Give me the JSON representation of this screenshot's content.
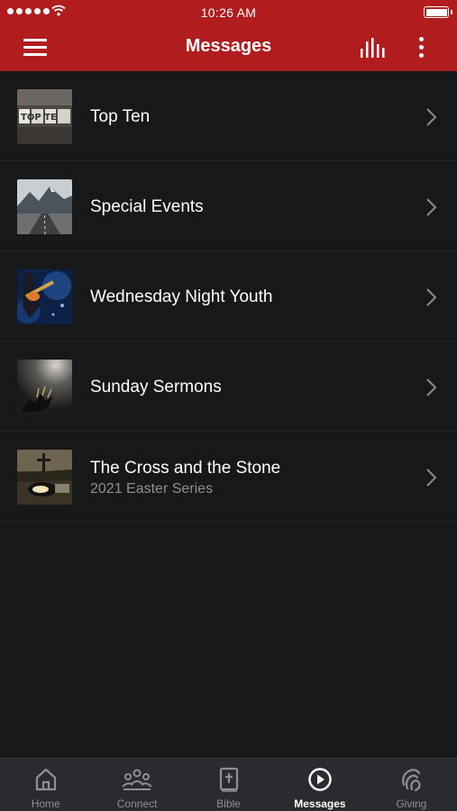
{
  "status_bar": {
    "time": "10:26 AM"
  },
  "header": {
    "title": "Messages"
  },
  "messages": [
    {
      "title": "Top Ten",
      "subtitle": "",
      "thumb_icon": "top-ten-thumbnail"
    },
    {
      "title": "Special Events",
      "subtitle": "",
      "thumb_icon": "mountain-road-thumbnail"
    },
    {
      "title": "Wednesday Night Youth",
      "subtitle": "",
      "thumb_icon": "guitar-player-thumbnail"
    },
    {
      "title": "Sunday Sermons",
      "subtitle": "",
      "thumb_icon": "hands-light-thumbnail"
    },
    {
      "title": "The Cross and the Stone",
      "subtitle": "2021 Easter Series",
      "thumb_icon": "cross-stone-thumbnail"
    }
  ],
  "tabs": [
    {
      "label": "Home",
      "icon": "home-icon",
      "active": false
    },
    {
      "label": "Connect",
      "icon": "people-icon",
      "active": false
    },
    {
      "label": "Bible",
      "icon": "bible-icon",
      "active": false
    },
    {
      "label": "Messages",
      "icon": "play-circle-icon",
      "active": true
    },
    {
      "label": "Giving",
      "icon": "giving-icon",
      "active": false
    }
  ],
  "colors": {
    "header_bg": "#b11d1f",
    "background": "#17181a",
    "tabbar_bg": "#2a2b2e",
    "inactive_tab": "#8f9094",
    "active_tab": "#ffffff"
  }
}
